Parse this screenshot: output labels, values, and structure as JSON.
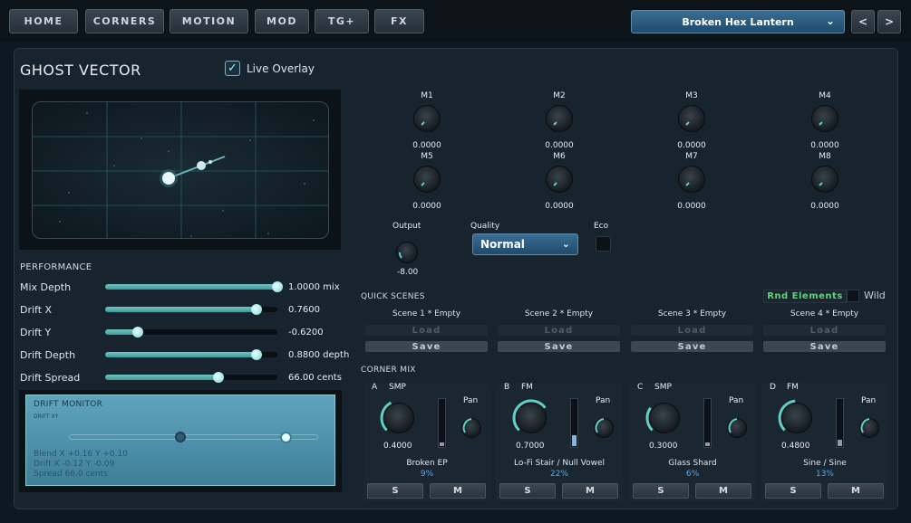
{
  "nav": {
    "tabs": [
      "HOME",
      "CORNERS",
      "MOTION",
      "MOD",
      "TG+",
      "FX"
    ],
    "preset": "Broken Hex Lantern",
    "prev": "<",
    "next": ">"
  },
  "panel": {
    "title": "GHOST VECTOR",
    "live_overlay_label": "Live Overlay",
    "live_overlay_checked": true
  },
  "performance": {
    "heading": "PERFORMANCE",
    "sliders": [
      {
        "label": "Mix Depth",
        "value": "1.0000 mix",
        "level": 1.0
      },
      {
        "label": "Drift X",
        "value": "0.7600",
        "level": 0.88
      },
      {
        "label": "Drift Y",
        "value": "-0.6200",
        "level": 0.19
      },
      {
        "label": "Drift Depth",
        "value": "0.8800 depth",
        "level": 0.88
      },
      {
        "label": "Drift Spread",
        "value": "66.00 cents",
        "level": 0.66
      }
    ]
  },
  "drift_monitor": {
    "title": "DRIFT MONITOR",
    "subtitle": "DRIFT XY",
    "blend": "Blend  X +0.16   Y +0.10",
    "drift": "Drift  X -0.12   Y -0.09",
    "spread": "Spread  66.0 cents"
  },
  "macros": [
    {
      "label": "M1",
      "value": "0.0000"
    },
    {
      "label": "M2",
      "value": "0.0000"
    },
    {
      "label": "M3",
      "value": "0.0000"
    },
    {
      "label": "M4",
      "value": "0.0000"
    },
    {
      "label": "M5",
      "value": "0.0000"
    },
    {
      "label": "M6",
      "value": "0.0000"
    },
    {
      "label": "M7",
      "value": "0.0000"
    },
    {
      "label": "M8",
      "value": "0.0000"
    }
  ],
  "output": {
    "label": "Output",
    "value": "-8.00"
  },
  "quality": {
    "label": "Quality",
    "value": "Normal"
  },
  "eco": {
    "label": "Eco"
  },
  "quick_scenes": {
    "heading": "QUICK SCENES",
    "rnd_elements": "Rnd Elements",
    "wild": "Wild",
    "scenes": [
      {
        "title": "Scene 1 * Empty",
        "load": "Load",
        "save": "Save"
      },
      {
        "title": "Scene 2 * Empty",
        "load": "Load",
        "save": "Save"
      },
      {
        "title": "Scene 3 * Empty",
        "load": "Load",
        "save": "Save"
      },
      {
        "title": "Scene 4 * Empty",
        "load": "Load",
        "save": "Save"
      }
    ]
  },
  "corner_mix": {
    "heading": "CORNER MIX",
    "corners": [
      {
        "letter": "A",
        "type": "SMP",
        "pan": "Pan",
        "value": "0.4000",
        "name": "Broken EP",
        "pct": "9%",
        "s": "S",
        "m": "M"
      },
      {
        "letter": "B",
        "type": "FM",
        "pan": "Pan",
        "value": "0.7000",
        "name": "Lo-Fi Stair / Null Vowel",
        "pct": "22%",
        "s": "S",
        "m": "M"
      },
      {
        "letter": "C",
        "type": "SMP",
        "pan": "Pan",
        "value": "0.3000",
        "name": "Glass Shard",
        "pct": "6%",
        "s": "S",
        "m": "M"
      },
      {
        "letter": "D",
        "type": "FM",
        "pan": "Pan",
        "value": "0.4800",
        "name": "Sine / Sine",
        "pct": "13%",
        "s": "S",
        "m": "M"
      }
    ]
  },
  "colors": {
    "accent": "#3b6e93",
    "teal": "#6fc6c4",
    "green": "#56d777",
    "pct_blue": "#5aa6e8"
  }
}
